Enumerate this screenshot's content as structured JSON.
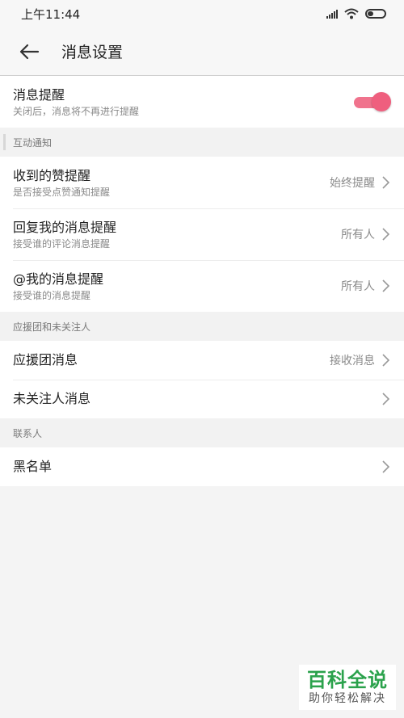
{
  "status_bar": {
    "time": "上午11:44"
  },
  "header": {
    "title": "消息设置"
  },
  "reminder": {
    "title": "消息提醒",
    "subtitle": "关闭后，消息将不再进行提醒",
    "enabled": true,
    "accent_color": "#ef5f7e"
  },
  "groups": {
    "interaction": {
      "label": "互动通知",
      "items": [
        {
          "title": "收到的赞提醒",
          "subtitle": "是否接受点赞通知提醒",
          "value": "始终提醒"
        },
        {
          "title": "回复我的消息提醒",
          "subtitle": "接受谁的评论消息提醒",
          "value": "所有人"
        },
        {
          "title": "@我的消息提醒",
          "subtitle": "接受谁的消息提醒",
          "value": "所有人"
        }
      ]
    },
    "support": {
      "label": "应援团和未关注人",
      "items": [
        {
          "title": "应援团消息",
          "value": "接收消息"
        },
        {
          "title": "未关注人消息",
          "value": ""
        }
      ]
    },
    "contacts": {
      "label": "联系人",
      "items": [
        {
          "title": "黑名单"
        }
      ]
    }
  },
  "watermark": {
    "main": "百科全说",
    "sub": "助你轻松解决"
  }
}
